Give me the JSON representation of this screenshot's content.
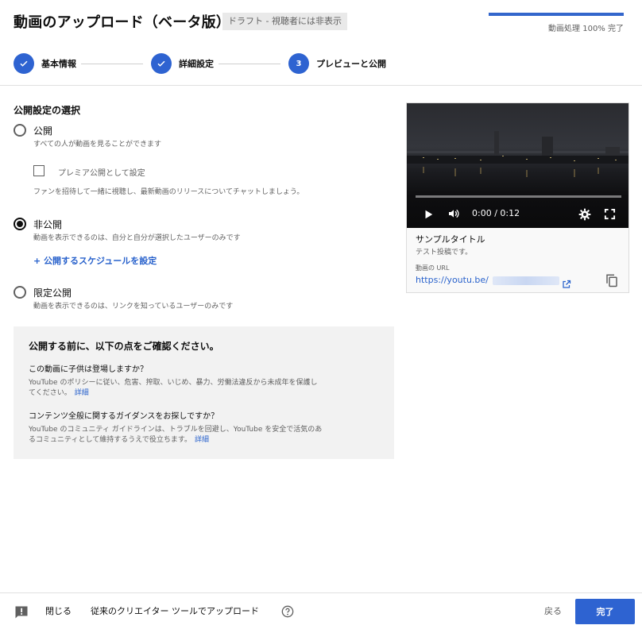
{
  "header": {
    "title": "動画のアップロード（ベータ版）",
    "draft_badge": "ドラフト - 視聴者には非表示",
    "processing_text": "動画処理 100% 完了",
    "processing_percent": 100
  },
  "stepper": {
    "steps": [
      {
        "label": "基本情報",
        "status": "done",
        "icon": "check-icon"
      },
      {
        "label": "詳細設定",
        "status": "done",
        "icon": "check-icon"
      },
      {
        "label": "プレビューと公開",
        "status": "current",
        "number": "3"
      }
    ]
  },
  "visibility": {
    "section_title": "公開設定の選択",
    "public": {
      "label": "公開",
      "description": "すべての人が動画を見ることができます",
      "premiere_label": "プレミア公開として設定",
      "premiere_checked": false,
      "premiere_description": "ファンを招待して一緒に視聴し、最新動画のリリースについてチャットしましょう。"
    },
    "private": {
      "label": "非公開",
      "description": "動画を表示できるのは、自分と自分が選択したユーザーのみです",
      "schedule_link": "+ 公開するスケジュールを設定",
      "checked": true
    },
    "unlisted": {
      "label": "限定公開",
      "description": "動画を表示できるのは、リンクを知っているユーザーのみです"
    }
  },
  "checklist": {
    "title": "公開する前に、以下の点をご確認ください。",
    "q1": "この動画に子供は登場しますか？",
    "p1": "YouTube のポリシーに従い、危害、搾取、いじめ、暴力、労働法違反から未成年を保護してください。",
    "p1_link": "詳細",
    "q2": "コンテンツ全般に関するガイダンスをお探しですか？",
    "p2": "YouTube のコミュニティ ガイドラインは、トラブルを回避し、YouTube を安全で活気のあるコミュニティとして維持するうえで役立ちます。",
    "p2_link": "詳細"
  },
  "preview": {
    "time": "0:00 / 0:12",
    "video_title": "サンプルタイトル",
    "video_description": "テスト投稿です。",
    "url_label": "動画の URL",
    "url": "https://youtu.be/"
  },
  "footer": {
    "close": "閉じる",
    "classic_tool": "従来のクリエイター ツールでアップロード",
    "back": "戻る",
    "done": "完了"
  },
  "colors": {
    "accent": "#2e63d1",
    "link": "#2962cc"
  }
}
